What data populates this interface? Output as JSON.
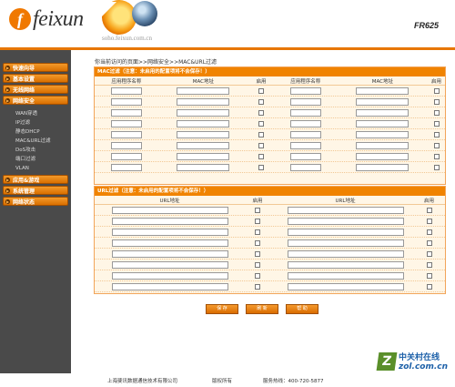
{
  "header": {
    "brand": "feixun",
    "domain": "soho.feixun.com.cn",
    "model": "FR625"
  },
  "sidebar": {
    "items": [
      {
        "label": "快速向导"
      },
      {
        "label": "基本设置"
      },
      {
        "label": "无线网络"
      },
      {
        "label": "网络安全",
        "children": [
          "WAN穿透",
          "IP过滤",
          "静态DHCP",
          "MAC&URL过滤",
          "DoS攻击",
          "端口过滤",
          "VLAN"
        ]
      },
      {
        "label": "应用&游戏"
      },
      {
        "label": "系统管理"
      },
      {
        "label": "网络状态"
      }
    ]
  },
  "breadcrumb": "你当前访问的页面>>网络安全>>MAC&URL过滤",
  "mac_filter": {
    "title": "MAC过滤（注意：未启用的配置项将不会保存！）",
    "headers": [
      "应用程序名称",
      "MAC地址",
      "启用",
      "应用程序名称",
      "MAC地址",
      "启用"
    ],
    "rows": 8
  },
  "url_filter": {
    "title": "URL过滤（注意：未启用的配置项将不会保存！）",
    "headers": [
      "URL地址",
      "启用",
      "URL地址",
      "启用"
    ],
    "rows": 8
  },
  "buttons": {
    "save": "保 存",
    "refresh": "刷 新",
    "help": "帮 助"
  },
  "footer": {
    "company": "上海斐讯数据通信技术有限公司",
    "rights": "版权所有",
    "hotline": "服务热线：400-720-5877"
  },
  "watermark": {
    "cn": "中关村在线",
    "en": "zol.com.cn",
    "logo_letter": "Z"
  },
  "colors": {
    "accent": "#f08300",
    "sidebar": "#4a4a4a",
    "panel_bg": "#fff6e6"
  }
}
